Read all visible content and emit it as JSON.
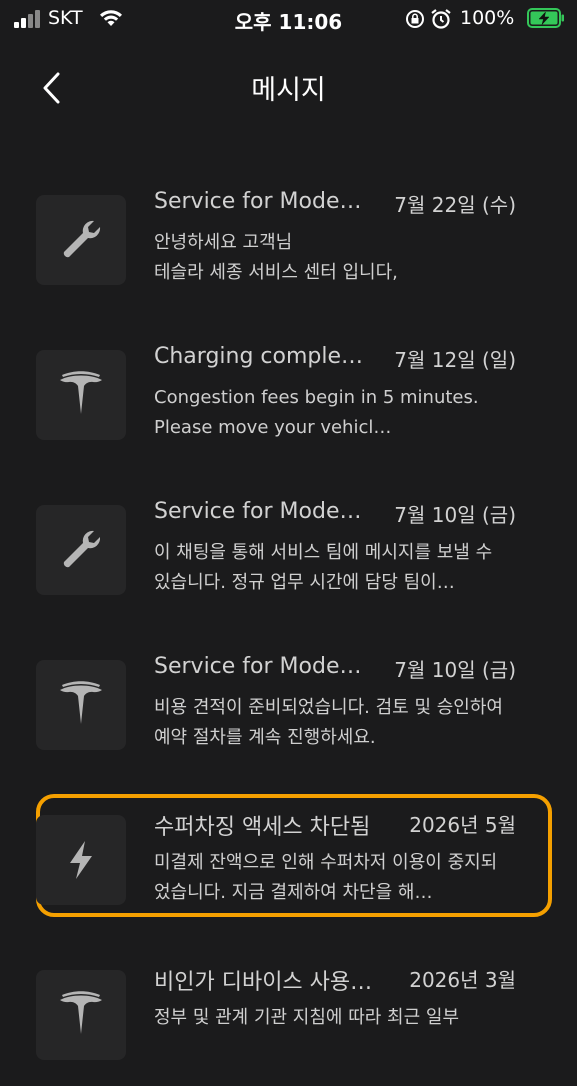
{
  "status_bar": {
    "carrier": "SKT",
    "time": "오후 11:06",
    "battery_percent": "100%",
    "battery_level": 1.0,
    "icons": [
      "signal-icon",
      "wifi-icon",
      "orientation-lock-icon",
      "alarm-icon",
      "battery-charging-icon"
    ],
    "battery_color": "#34c759"
  },
  "header": {
    "title": "메시지",
    "back_icon": "chevron-left-icon"
  },
  "colors": {
    "background": "#1b1b1c",
    "highlight_border": "#f5a000"
  },
  "messages": [
    {
      "icon": "wrench-icon",
      "title": "Service for Model Y",
      "title_display": "Service for Mode…",
      "date": "7월 22일 (수)",
      "body": "안녕하세요 고객님\n테슬라 세종 서비스 센터 입니다,"
    },
    {
      "icon": "tesla-logo-icon",
      "title": "Charging comple…",
      "date": "7월 12일 (일)",
      "body": "Congestion fees begin in 5 minutes. Please move your vehicl…"
    },
    {
      "icon": "wrench-icon",
      "title": "Service for Mode…",
      "date": "7월 10일 (금)",
      "body": "이 채팅을 통해 서비스 팀에 메시지를 보낼 수 있습니다. 정규 업무 시간에 담당 팀이…"
    },
    {
      "icon": "tesla-logo-icon",
      "title": "Service for Mode…",
      "date": "7월 10일 (금)",
      "body": "비용 견적이 준비되었습니다. 검토 및 승인하여 예약 절차를 계속 진행하세요."
    },
    {
      "icon": "lightning-bolt-icon",
      "title": "수퍼차징 액세스 차단됨",
      "date": "2026년 5월",
      "body": "미결제 잔액으로 인해 수퍼차저 이용이 중지되었습니다. 지금 결제하여 차단을 해…",
      "highlighted": true
    },
    {
      "icon": "tesla-logo-icon",
      "title": "비인가 디바이스 사용…",
      "date": "2026년 3월",
      "body": "정부 및 관계 기관 지침에 따라 최근 일부"
    }
  ]
}
